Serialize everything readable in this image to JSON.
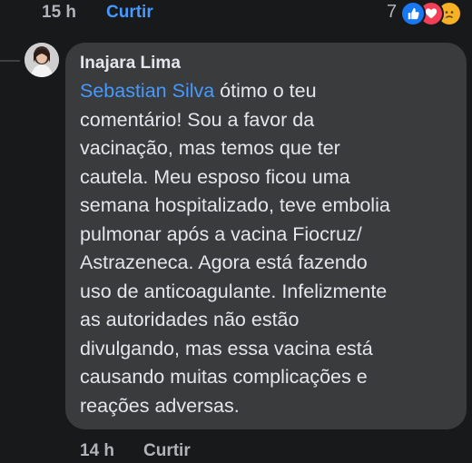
{
  "previous_comment": {
    "time": "15 h",
    "like_label": "Curtir",
    "reaction_count": "7",
    "reactions": [
      "like-icon",
      "love-icon",
      "sad-icon"
    ],
    "colors": {
      "like": "#1877f2",
      "love": "#f33e58",
      "sad": "#f7b125"
    }
  },
  "reply": {
    "author": "Inajara Lima",
    "mention": "Sebastian Silva",
    "first_line_rest": " ótimo o teu",
    "lines": [
      "comentário! Sou a favor da",
      "vacinação, mas temos que ter",
      "cautela. Meu esposo ficou uma",
      "semana hospitalizado, teve embolia",
      "pulmonar após a vacina Fiocruz/",
      "Astrazeneca. Agora está fazendo",
      "uso de anticoagulante. Infelizmente",
      "as autoridades não estão",
      "divulgando, mas essa vacina está",
      "causando muitas complicações e",
      "reações adversas."
    ],
    "time": "14 h",
    "like_label": "Curtir"
  },
  "colors": {
    "background": "#18191a",
    "bubble": "#3a3b3c",
    "text": "#e4e6eb",
    "muted": "#b0b3b8",
    "link": "#4599ff"
  }
}
